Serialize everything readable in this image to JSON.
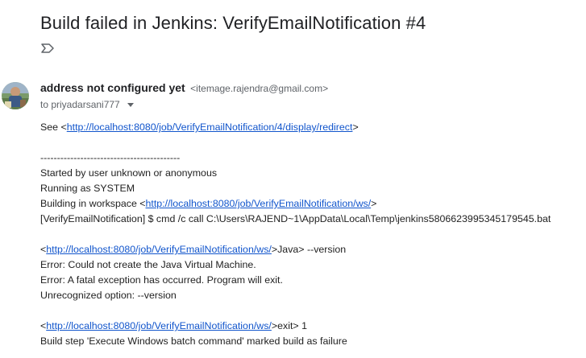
{
  "email": {
    "subject": "Build failed in Jenkins: VerifyEmailNotification #4",
    "label_icon": "label-arrow-icon",
    "sender": {
      "name": "address not configured yet",
      "email": "<itemage.rajendra@gmail.com>",
      "to": "to priyadarsani777",
      "avatar_icon": "user-avatar-photo"
    },
    "body": {
      "see_prefix": "See <",
      "see_link": "http://localhost:8080/job/VerifyEmailNotification/4/display/redirect",
      "see_suffix": ">",
      "separator": "------------------------------------------",
      "started_by": "Started by user unknown or anonymous",
      "running_as": "Running as SYSTEM",
      "workspace_prefix": "Building in workspace <",
      "workspace_link": "http://localhost:8080/job/VerifyEmailNotification/ws/",
      "workspace_suffix": ">",
      "cmd_line": "[VerifyEmailNotification] $ cmd /c call C:\\Users\\RAJEND~1\\AppData\\Local\\Temp\\jenkins5806623995345179545.bat",
      "java_prefix": "<",
      "java_link": "http://localhost:8080/job/VerifyEmailNotification/ws/",
      "java_suffix": ">Java> --version",
      "error1": "Error: Could not create the Java Virtual Machine.",
      "error2": "Error: A fatal exception has occurred. Program will exit.",
      "unrecognized": "Unrecognized option: --version",
      "exit_prefix": "<",
      "exit_link": "http://localhost:8080/job/VerifyEmailNotification/ws/",
      "exit_suffix": ">exit> 1",
      "build_step": "Build step 'Execute Windows batch command' marked build as failure"
    }
  }
}
